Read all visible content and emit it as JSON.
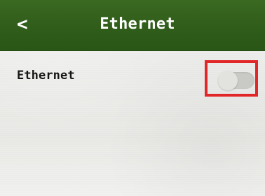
{
  "header": {
    "back_label": "<",
    "title": "Ethernet"
  },
  "settings": {
    "ethernet": {
      "label": "Ethernet",
      "enabled": false
    }
  },
  "colors": {
    "header_background": "#2d5a18",
    "header_text": "#ffffff",
    "content_background": "#ececea",
    "label_text": "#161616",
    "toggle_track": "#c9c9c6",
    "toggle_knob": "#e2e2df",
    "highlight_border": "#e12727"
  }
}
